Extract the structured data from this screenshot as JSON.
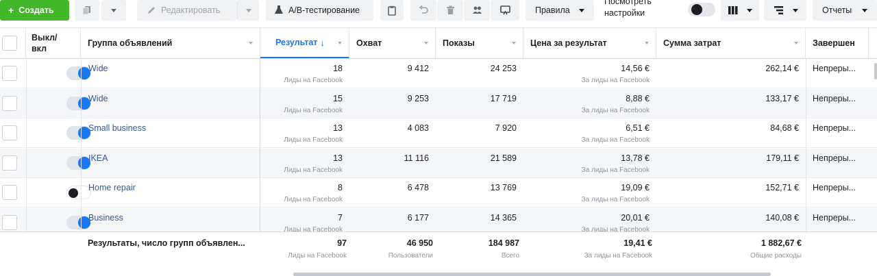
{
  "toolbar": {
    "create_label": "Создать",
    "edit_label": "Редактировать",
    "ab_label": "A/B-тестирование",
    "rules_label": "Правила",
    "view_settings_label": "Посмотреть настройки",
    "reports_label": "Отчеты"
  },
  "columns": {
    "toggle": "Выкл/ вкл",
    "adset": "Группа объявлений",
    "results": "Результат",
    "results_arrow": "↓",
    "reach": "Охват",
    "impressions": "Показы",
    "cost": "Цена за результат",
    "spent": "Сумма затрат",
    "end": "Завершен"
  },
  "rows": [
    {
      "name": "Wide",
      "on": true,
      "results": "18",
      "results_sub": "Лиды на Facebook",
      "reach": "9 412",
      "impressions": "24 253",
      "cost": "14,56 €",
      "cost_sub": "За лиды на Facebook",
      "spent": "262,14 €",
      "end": "Непреры..."
    },
    {
      "name": "Wide",
      "on": true,
      "results": "15",
      "results_sub": "Лиды на Facebook",
      "reach": "9 253",
      "impressions": "17 719",
      "cost": "8,88 €",
      "cost_sub": "За лиды на Facebook",
      "spent": "133,17 €",
      "end": "Непреры..."
    },
    {
      "name": "Small business",
      "on": true,
      "results": "13",
      "results_sub": "Лиды на Facebook",
      "reach": "4 083",
      "impressions": "7 920",
      "cost": "6,51 €",
      "cost_sub": "За лиды на Facebook",
      "spent": "84,68 €",
      "end": "Непреры..."
    },
    {
      "name": "IKEA",
      "on": true,
      "results": "13",
      "results_sub": "Лиды на Facebook",
      "reach": "11 116",
      "impressions": "21 589",
      "cost": "13,78 €",
      "cost_sub": "За лиды на Facebook",
      "spent": "179,11 €",
      "end": "Непреры..."
    },
    {
      "name": "Home repair",
      "on": false,
      "results": "8",
      "results_sub": "Лиды на Facebook",
      "reach": "6 478",
      "impressions": "13 769",
      "cost": "19,09 €",
      "cost_sub": "За лиды на Facebook",
      "spent": "152,71 €",
      "end": "Непреры..."
    },
    {
      "name": "Business",
      "on": true,
      "results": "7",
      "results_sub": "Лиды на Facebook",
      "reach": "6 177",
      "impressions": "14 365",
      "cost": "20,01 €",
      "cost_sub": "За лиды на Facebook",
      "spent": "140,08 €",
      "end": "Непреры..."
    }
  ],
  "summary": {
    "label": "Результаты, число групп объявлен...",
    "results": "97",
    "results_sub": "Лиды на Facebook",
    "reach": "46 950",
    "reach_sub": "Пользователи",
    "impressions": "184 987",
    "impressions_sub": "Всего",
    "cost": "19,41 €",
    "cost_sub": "За лиды на Facebook",
    "spent": "1 882,67 €",
    "spent_sub": "Общие расходы"
  },
  "colors": {
    "accent": "#1877f2",
    "create_green": "#42b72a",
    "link": "#385898"
  }
}
